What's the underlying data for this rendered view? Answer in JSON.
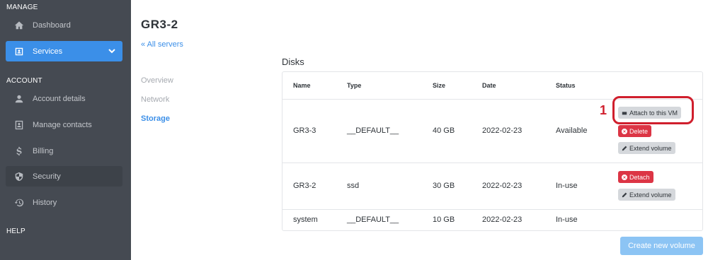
{
  "sidebar": {
    "sections": {
      "manage": "MANAGE",
      "account": "ACCOUNT",
      "help": "HELP"
    },
    "items": [
      {
        "label": "Dashboard",
        "icon": "home-icon"
      },
      {
        "label": "Services",
        "icon": "id-card-icon",
        "active": true
      },
      {
        "label": "Account details",
        "icon": "user-icon"
      },
      {
        "label": "Manage contacts",
        "icon": "contacts-icon"
      },
      {
        "label": "Billing",
        "icon": "dollar-icon"
      },
      {
        "label": "Security",
        "icon": "shield-icon"
      },
      {
        "label": "History",
        "icon": "history-icon"
      }
    ]
  },
  "page": {
    "title": "GR3-2",
    "back_link": "« All servers"
  },
  "subnav": [
    "Overview",
    "Network",
    "Storage"
  ],
  "disks": {
    "title": "Disks",
    "columns": [
      "Name",
      "Type",
      "Size",
      "Date",
      "Status"
    ],
    "rows": [
      {
        "name": "GR3-3",
        "type": "__DEFAULT__",
        "size": "40 GB",
        "date": "2022-02-23",
        "status": "Available",
        "actions": [
          "Attach to this VM",
          "Delete",
          "Extend volume"
        ]
      },
      {
        "name": "GR3-2",
        "type": "ssd",
        "size": "30 GB",
        "date": "2022-02-23",
        "status": "In-use",
        "actions": [
          "Detach",
          "Extend volume"
        ]
      },
      {
        "name": "system",
        "type": "__DEFAULT__",
        "size": "10 GB",
        "date": "2022-02-23",
        "status": "In-use",
        "actions": []
      }
    ],
    "create_button": "Create new volume"
  },
  "annotation": {
    "number": "1",
    "color": "#d01f2d"
  },
  "colors": {
    "accent": "#3b8fe8",
    "danger": "#dc3545",
    "sidebar": "#454a52"
  }
}
